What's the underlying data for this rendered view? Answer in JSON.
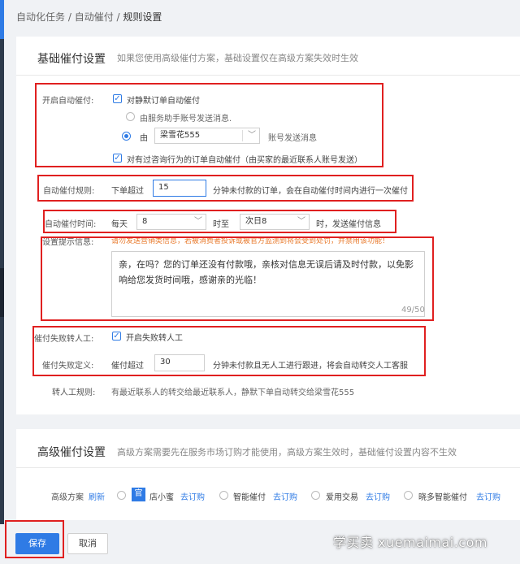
{
  "breadcrumb": {
    "item1": "自动化任务",
    "sep1": " / ",
    "item2": "自动催付",
    "sep2": " / ",
    "current": "规则设置"
  },
  "basic": {
    "title": "基础催付设置",
    "desc": "如果您使用高级催付方案，基础设置仅在高级方案失效时生效",
    "enable_label": "开启自动催付:",
    "silent_order_checkbox": "对静默订单自动催付",
    "radio_assistant": "由服务助手账号发送消息.",
    "radio_by": "由",
    "account_select": "梁雪花555",
    "account_suffix": "账号发送消息",
    "consult_checkbox": "对有过咨询行为的订单自动催付（由买家的最近联系人账号发送）",
    "rule_label": "自动催付规则:",
    "rule_prefix": "下单超过",
    "rule_value": "15",
    "rule_suffix": "分钟未付款的订单，会在自动催付时间内进行一次催付",
    "time_label": "自动催付时间:",
    "time_prefix": "每天",
    "time_start": "8",
    "time_to": "时至",
    "time_end": "次日8",
    "time_suffix": "时，发送催付信息",
    "message_label": "设置提示信息:",
    "message_warning": "请勿发送营销类信息，若被消费者投诉或被官方监测到将会受到处罚，并禁用该功能！",
    "message_text": "亲，在吗？您的订单还没有付款哦，亲核对信息无误后请及时付款，以免影响给您发货时间哦，感谢亲的光临！",
    "message_counter": "49/50",
    "transfer_label": "催付失败转人工:",
    "transfer_checkbox": "开启失败转人工",
    "fail_label": "催付失败定义:",
    "fail_prefix": "催付超过",
    "fail_value": "30",
    "fail_suffix": "分钟未付款且无人工进行跟进，将会自动转交人工客服",
    "transfer_rule_label": "转人工规则:",
    "transfer_rule_text": "有最近联系人的转交给最近联系人，静默下单自动转交给梁雪花555"
  },
  "advanced": {
    "title": "高级催付设置",
    "desc": "高级方案需要先在服务市场订购才能使用，高级方案生效时，基础催付设置内容不生效",
    "plan_label": "高级方案",
    "refresh": "刷新",
    "plans": [
      {
        "badge": "官",
        "name": "店小蜜",
        "link": "去订购"
      },
      {
        "name": "智能催付",
        "link": "去订购"
      },
      {
        "name": "爱用交易",
        "link": "去订购"
      },
      {
        "name": "晓多智能催付",
        "link": "去订购"
      }
    ]
  },
  "footer": {
    "save": "保存",
    "cancel": "取消"
  },
  "watermark": "学买卖 xuemaimai.com",
  "colors": {
    "primary": "#2f7be5",
    "highlight": "#e02020",
    "warning": "#e87a2c"
  }
}
